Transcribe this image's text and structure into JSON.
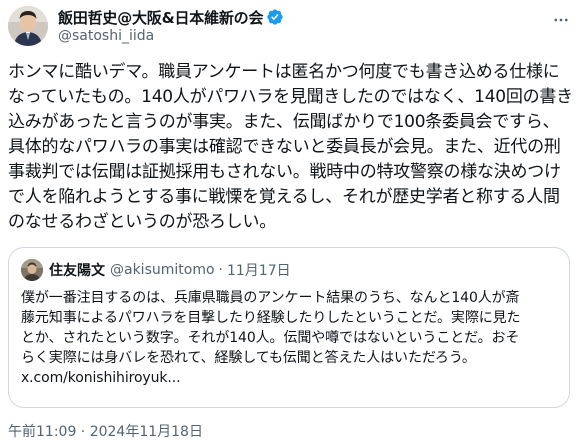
{
  "author": {
    "display_name": "飯田哲史@大阪&日本維新の会",
    "handle": "@satoshi_iida",
    "verified_icon": "verified-badge-icon",
    "avatar_icon": "avatar"
  },
  "tweet": {
    "text": "ホンマに酷いデマ。職員アンケートは匿名かつ何度でも書き込める仕様に\nなっていたもの。140人がパワハラを見聞きしたのではなく、140回の書き\n込みがあったと言うのが事実。また、伝聞ばかりで100条委員会ですら、\n具体的なパワハラの事実は確認できないと委員長が会見。また、近代の刑\n事裁判では伝聞は証拠採用もされない。戦時中の特攻警察の様な決めつけ\nで人を陥れようとする事に戦慄を覚えるし、それが歴史学者と称する人間\nのなせるわざというのが恐ろしい。",
    "timestamp": "午前11:09 · 2024年11月18日"
  },
  "quote": {
    "display_name": "住友陽文",
    "handle": "@akisumitomo",
    "separator": "·",
    "date": "11月17日",
    "text": "僕が一番注目するのは、兵庫県職員のアンケート結果のうち、なんと140人が斎\n藤元知事によるパワハラを目撃したり経験したりしたということだ。実際に見た\nとか、されたという数字。それが140人。伝聞や噂ではないということだ。おそ\nらく実際には身バレを恐れて、経験しても伝聞と答えた人はいただろう。\nx.com/konishihiroyuk..."
  },
  "colors": {
    "text_primary": "#0f1419",
    "text_secondary": "#536471",
    "verified_blue": "#1d9bf0",
    "border": "#cfd9de"
  }
}
